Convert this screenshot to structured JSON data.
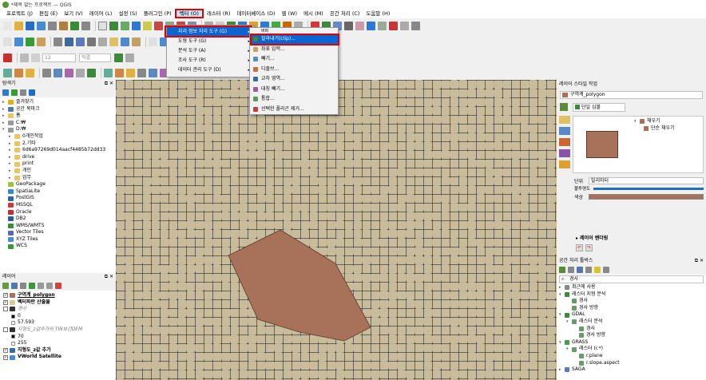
{
  "window": {
    "title": "*제목 없는 프로젝트 — QGIS"
  },
  "menu": [
    "프로젝트 (J)",
    "편집 (E)",
    "보기 (V)",
    "레이어 (L)",
    "설정 (S)",
    "플러그인 (P)",
    "벡터 (O)",
    "래스터 (R)",
    "데이터베이스 (D)",
    "웹 (W)",
    "메시 (M)",
    "공간 처리 (C)",
    "도움말 (H)"
  ],
  "vector_menu": {
    "items": [
      "지리 정보 처리 도구 (G)",
      "도형 도구 (G)",
      "분석 도구 (A)",
      "조사 도구 (R)",
      "데이터 관리 도구 (D)"
    ]
  },
  "geoprocessing_submenu": {
    "items": [
      "잘라내기(clip)...",
      "좌표 입력...",
      "빼기...",
      "디졸브...",
      "교차 영역...",
      "대칭 빼기...",
      "통합...",
      "선택한 폴리곤 제거..."
    ],
    "partial_header": "버퍼"
  },
  "toolbar": {
    "font_size": "12",
    "unit_combo": "직결"
  },
  "browser": {
    "title": "탐색기",
    "items": [
      {
        "label": "즐겨찾기",
        "icon": "star-icon",
        "depth": 0,
        "expanded": false
      },
      {
        "label": "공간 북마크",
        "icon": "bookmark-icon",
        "depth": 0,
        "expanded": false
      },
      {
        "label": "홈",
        "icon": "folder-icon",
        "depth": 0,
        "expanded": false
      },
      {
        "label": "C:₩",
        "icon": "drive-icon",
        "depth": 0,
        "expanded": false
      },
      {
        "label": "D:₩",
        "icon": "drive-icon",
        "depth": 0,
        "expanded": true
      },
      {
        "label": "0개인작업",
        "icon": "folder-icon",
        "depth": 1,
        "expanded": false
      },
      {
        "label": "2.기타",
        "icon": "folder-icon",
        "depth": 1,
        "expanded": false
      },
      {
        "label": "6d6a97269d014aacf4485b72dd33",
        "icon": "folder-icon",
        "depth": 1,
        "expanded": false
      },
      {
        "label": "drive",
        "icon": "folder-icon",
        "depth": 1,
        "expanded": false
      },
      {
        "label": "print",
        "icon": "folder-icon",
        "depth": 1,
        "expanded": false
      },
      {
        "label": "개인",
        "icon": "folder-icon",
        "depth": 1,
        "expanded": false
      },
      {
        "label": "업무",
        "icon": "folder-icon",
        "depth": 1,
        "expanded": false
      },
      {
        "label": "GeoPackage",
        "icon": "geopackage-icon",
        "depth": 0,
        "expanded": false
      },
      {
        "label": "SpatiaLite",
        "icon": "spatialite-icon",
        "depth": 0,
        "expanded": false
      },
      {
        "label": "PostGIS",
        "icon": "postgis-icon",
        "depth": 0,
        "expanded": false
      },
      {
        "label": "MSSQL",
        "icon": "mssql-icon",
        "depth": 0,
        "expanded": false
      },
      {
        "label": "Oracle",
        "icon": "oracle-icon",
        "depth": 0,
        "expanded": false
      },
      {
        "label": "DB2",
        "icon": "db2-icon",
        "depth": 0,
        "expanded": false
      },
      {
        "label": "WMS/WMTS",
        "icon": "wms-icon",
        "depth": 0,
        "expanded": false
      },
      {
        "label": "Vector Tiles",
        "icon": "vector-tiles-icon",
        "depth": 0,
        "expanded": false
      },
      {
        "label": "XYZ Tiles",
        "icon": "xyz-icon",
        "depth": 0,
        "expanded": false
      },
      {
        "label": "WCS",
        "icon": "wcs-icon",
        "depth": 0,
        "expanded": false
      }
    ]
  },
  "layers": {
    "title": "레이어",
    "items": [
      {
        "label": "구역계_polygon",
        "type": "polygon",
        "checked": true,
        "bold": true,
        "underline": true,
        "color": "#a8725a"
      },
      {
        "label": "벡터파란 산출물",
        "type": "polygon",
        "checked": true,
        "bold": true,
        "color": "#d8c8a0"
      },
      {
        "label": "경사",
        "type": "raster",
        "checked": false,
        "italic": true
      },
      {
        "label": "0",
        "type": "legend",
        "color": "#000000"
      },
      {
        "label": "57.593",
        "type": "legend",
        "color": "#ffffff"
      },
      {
        "label": "지형도_z값추가의 TIN보간DEM",
        "type": "raster",
        "checked": false,
        "italic": true
      },
      {
        "label": "70",
        "type": "legend",
        "color": "#000000"
      },
      {
        "label": "255",
        "type": "legend",
        "color": "#ffffff"
      },
      {
        "label": "지형도_z값 추가",
        "type": "line",
        "checked": true,
        "bold": true
      },
      {
        "label": "VWorld Satellite",
        "type": "xyz",
        "checked": true,
        "bold": true
      }
    ]
  },
  "style_panel": {
    "title": "레이어 스타일 작업",
    "layer": "구역계_polygon",
    "renderer": "단일 심볼",
    "fill_label": "채우기",
    "fill_sub": "단순 채우기",
    "unit_label": "단위",
    "unit_value": "밀리미터",
    "opacity_label": "불투명도",
    "color_label": "색상",
    "layer_render": "레이어 렌더링",
    "fill_color": "#a8725a"
  },
  "toolbox": {
    "title": "공간 처리 툴박스",
    "search": "경사",
    "items": [
      {
        "label": "최근에 사용",
        "depth": 0,
        "arrow": "▸"
      },
      {
        "label": "래스터 지형 분석",
        "depth": 0,
        "arrow": "▾"
      },
      {
        "label": "경사",
        "depth": 1,
        "arrow": ""
      },
      {
        "label": "경사 방향",
        "depth": 1,
        "arrow": ""
      },
      {
        "label": "GDAL",
        "depth": 0,
        "arrow": "▾"
      },
      {
        "label": "래스터 분석",
        "depth": 1,
        "arrow": "▾"
      },
      {
        "label": "경사",
        "depth": 2,
        "arrow": ""
      },
      {
        "label": "경사 방향",
        "depth": 2,
        "arrow": ""
      },
      {
        "label": "GRASS",
        "depth": 0,
        "arrow": "▾"
      },
      {
        "label": "래스터 (r.*)",
        "depth": 1,
        "arrow": "▾"
      },
      {
        "label": "r.plane",
        "depth": 2,
        "arrow": ""
      },
      {
        "label": "r.slope.aspect",
        "depth": 2,
        "arrow": ""
      },
      {
        "label": "SAGA",
        "depth": 0,
        "arrow": "▸"
      }
    ]
  }
}
